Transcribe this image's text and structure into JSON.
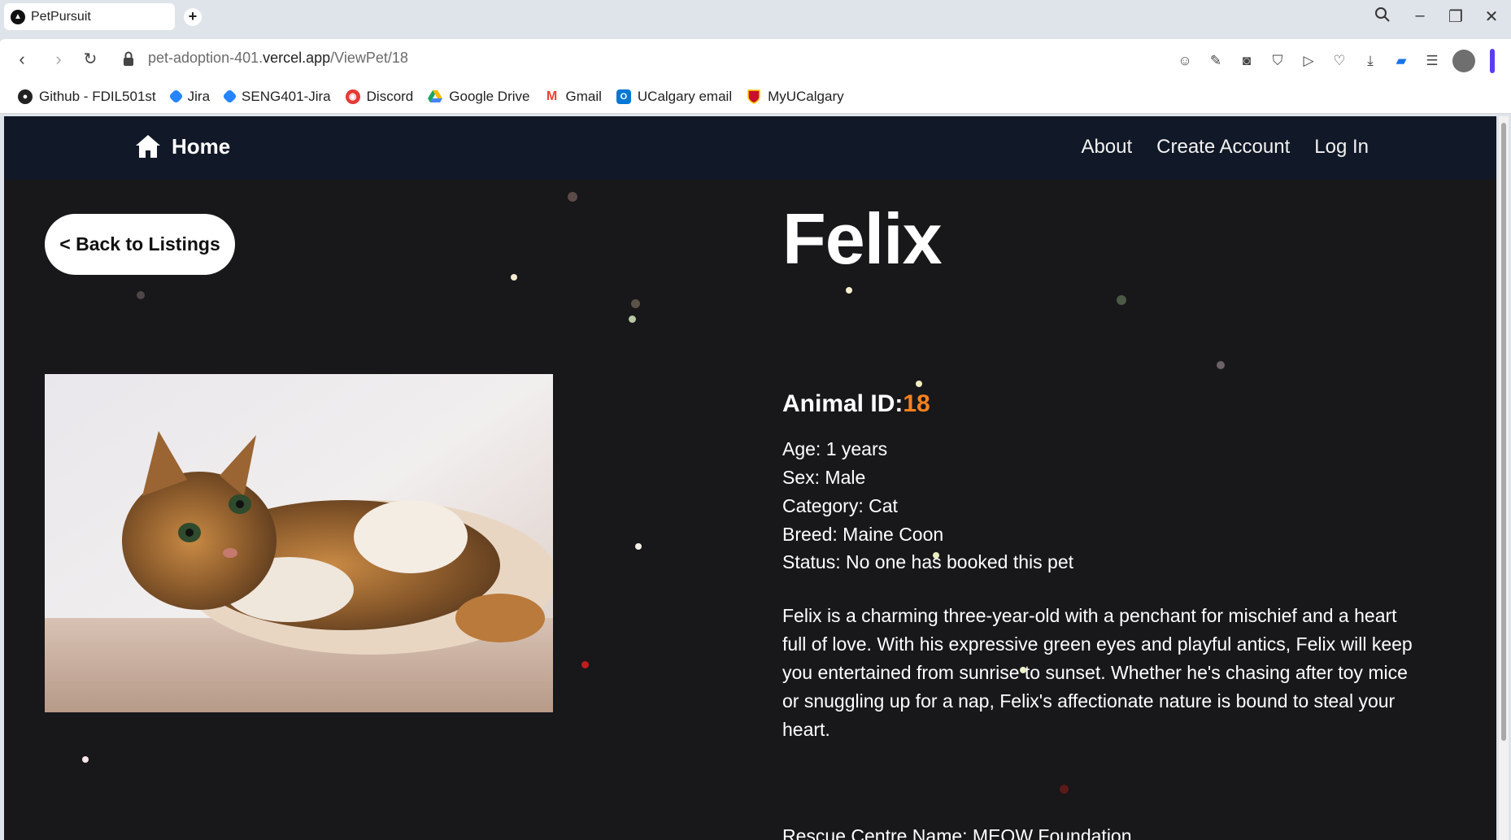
{
  "browser": {
    "tab_title": "PetPursuit",
    "url_prefix": "pet-adoption-401.",
    "url_host": "vercel.app",
    "url_path": "/ViewPet/18"
  },
  "bookmarks": [
    {
      "label": "Github - FDIL501st",
      "icon": "github-icon",
      "color": "#222222"
    },
    {
      "label": "Jira",
      "icon": "jira-icon",
      "color": "#2684ff"
    },
    {
      "label": "SENG401-Jira",
      "icon": "jira-icon",
      "color": "#2684ff"
    },
    {
      "label": "Discord",
      "icon": "discord-icon",
      "color": "#e53935"
    },
    {
      "label": "Google Drive",
      "icon": "google-drive-icon",
      "color": "#1fa463"
    },
    {
      "label": "Gmail",
      "icon": "gmail-icon",
      "color": "#ea4335"
    },
    {
      "label": "UCalgary email",
      "icon": "outlook-icon",
      "color": "#0078d4"
    },
    {
      "label": "MyUCalgary",
      "icon": "ucalgary-shield-icon",
      "color": "#c8102e"
    }
  ],
  "site_nav": {
    "home_label": "Home",
    "links": [
      "About",
      "Create Account",
      "Log In"
    ]
  },
  "page": {
    "back_button": "< Back to Listings",
    "pet_name": "Felix",
    "animal_id_label": "Animal ID:",
    "animal_id": "18",
    "age": "Age: 1 years",
    "sex": "Sex: Male",
    "category": "Category: Cat",
    "breed": "Breed: Maine Coon",
    "status": "Status: No one has booked this pet",
    "description": "Felix is a charming three-year-old with a penchant for mischief and a heart full of love. With his expressive green eyes and playful antics, Felix will keep you entertained from sunrise to sunset. Whether he's chasing after toy mice or snuggling up for a nap, Felix's affectionate nature is bound to steal your heart.",
    "rescue_centre": "Rescue Centre Name: MEOW Foundation"
  },
  "colors": {
    "nav_bg": "#111827",
    "page_bg": "#18171a",
    "accent_id": "#f58220"
  }
}
